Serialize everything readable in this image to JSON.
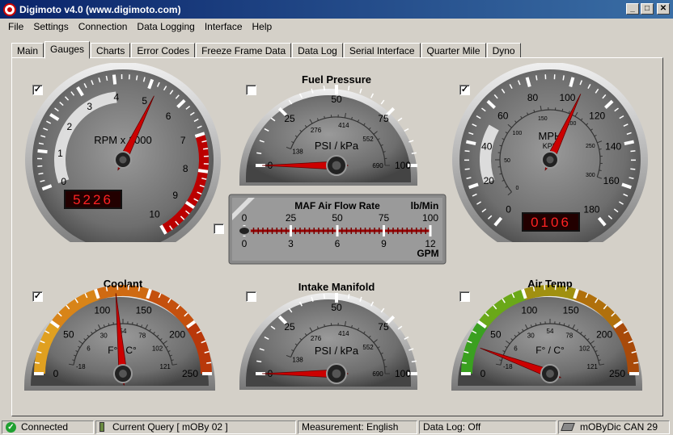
{
  "window": {
    "title": "Digimoto v4.0 (www.digimoto.com)"
  },
  "menu": [
    "File",
    "Settings",
    "Connection",
    "Data Logging",
    "Interface",
    "Help"
  ],
  "tabs": [
    {
      "label": "Main"
    },
    {
      "label": "Gauges",
      "active": true
    },
    {
      "label": "Charts"
    },
    {
      "label": "Error Codes"
    },
    {
      "label": "Freeze Frame Data"
    },
    {
      "label": "Data Log"
    },
    {
      "label": "Serial Interface"
    },
    {
      "label": "Quarter Mile"
    },
    {
      "label": "Dyno"
    }
  ],
  "gauges": {
    "rpm": {
      "checked": true,
      "label": "RPM x 1000",
      "ticks": [
        "0",
        "1",
        "2",
        "3",
        "4",
        "5",
        "6",
        "7",
        "8",
        "9",
        "10"
      ],
      "readout": "5226",
      "value": 5.226
    },
    "fuel": {
      "checked": false,
      "title": "Fuel Pressure",
      "unit": "PSI / kPa",
      "outer_ticks": [
        "0",
        "25",
        "50",
        "75",
        "100"
      ],
      "inner_ticks": [
        "138",
        "276",
        "414",
        "552",
        "690"
      ],
      "value": 0
    },
    "speed": {
      "checked": true,
      "unit_main": "MPH",
      "unit_sub": "KPH",
      "outer_ticks": [
        "0",
        "20",
        "40",
        "60",
        "80",
        "100",
        "120",
        "140",
        "160",
        "180"
      ],
      "inner_ticks": [
        "0",
        "50",
        "100",
        "150",
        "200",
        "250",
        "300"
      ],
      "readout": "0106",
      "value": 106
    },
    "maf": {
      "checked": false,
      "title": "MAF Air Flow Rate",
      "unit_top": "lb/Min",
      "unit_bottom": "GPM",
      "top_ticks": [
        "0",
        "25",
        "50",
        "75",
        "100"
      ],
      "bottom_ticks": [
        "0",
        "3",
        "6",
        "9",
        "12"
      ],
      "value": 0
    },
    "coolant": {
      "checked": true,
      "title": "Coolant",
      "unit": "F° / C°",
      "outer_ticks": [
        "0",
        "50",
        "100",
        "150",
        "200",
        "250"
      ],
      "inner_ticks": [
        "-18",
        "6",
        "30",
        "54",
        "78",
        "102",
        "121"
      ],
      "value": 118
    },
    "intake": {
      "checked": false,
      "title": "Intake Manifold",
      "unit": "PSI / kPa",
      "outer_ticks": [
        "0",
        "25",
        "50",
        "75",
        "100"
      ],
      "inner_ticks": [
        "138",
        "276",
        "414",
        "552",
        "690"
      ],
      "value": 0
    },
    "airtemp": {
      "checked": false,
      "title": "Air Temp",
      "unit": "F° / C°",
      "outer_ticks": [
        "0",
        "50",
        "100",
        "150",
        "200",
        "250"
      ],
      "inner_ticks": [
        "-18",
        "6",
        "30",
        "54",
        "78",
        "102",
        "121"
      ],
      "value": 28
    }
  },
  "status": {
    "connected": "Connected",
    "query": "Current Query [ mOBy 02 ]",
    "measurement": "Measurement: English",
    "datalog": "Data Log: Off",
    "interface": "mOByDic CAN 29"
  }
}
